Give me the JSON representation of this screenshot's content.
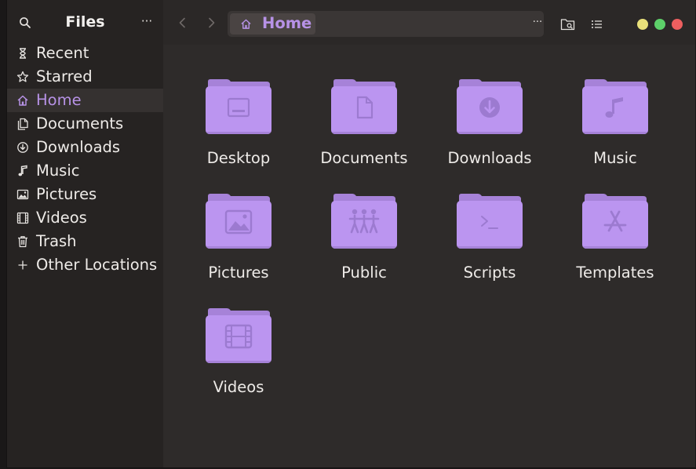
{
  "app": {
    "title": "Files",
    "menu_glyph": "···"
  },
  "colors": {
    "accent": "#b792e6",
    "folder_body": "#bb95f0",
    "folder_tab": "#a682d8",
    "folder_glyph": "#9c7ad0",
    "window_bg": "#2e2b2a",
    "sidebar_bg": "#262322",
    "close": "#ed5f5f",
    "maximize": "#5dd069",
    "minimize": "#e9e07a"
  },
  "sidebar": {
    "items": [
      {
        "label": "Recent",
        "icon": "clock-icon"
      },
      {
        "label": "Starred",
        "icon": "star-icon"
      },
      {
        "label": "Home",
        "icon": "home-icon",
        "active": true
      },
      {
        "label": "Documents",
        "icon": "document-icon"
      },
      {
        "label": "Downloads",
        "icon": "download-icon"
      },
      {
        "label": "Music",
        "icon": "music-icon"
      },
      {
        "label": "Pictures",
        "icon": "picture-icon"
      },
      {
        "label": "Videos",
        "icon": "film-icon"
      },
      {
        "label": "Trash",
        "icon": "trash-icon"
      },
      {
        "label": "Other Locations",
        "icon": "plus-icon"
      }
    ]
  },
  "pathbar": {
    "current": "Home",
    "menu_glyph": "···"
  },
  "folders": [
    {
      "label": "Desktop",
      "icon": "desktop-icon"
    },
    {
      "label": "Documents",
      "icon": "document-icon"
    },
    {
      "label": "Downloads",
      "icon": "download-icon"
    },
    {
      "label": "Music",
      "icon": "music-icon"
    },
    {
      "label": "Pictures",
      "icon": "picture-icon"
    },
    {
      "label": "Public",
      "icon": "people-icon"
    },
    {
      "label": "Scripts",
      "icon": "terminal-icon"
    },
    {
      "label": "Templates",
      "icon": "template-icon"
    },
    {
      "label": "Videos",
      "icon": "film-icon"
    }
  ]
}
